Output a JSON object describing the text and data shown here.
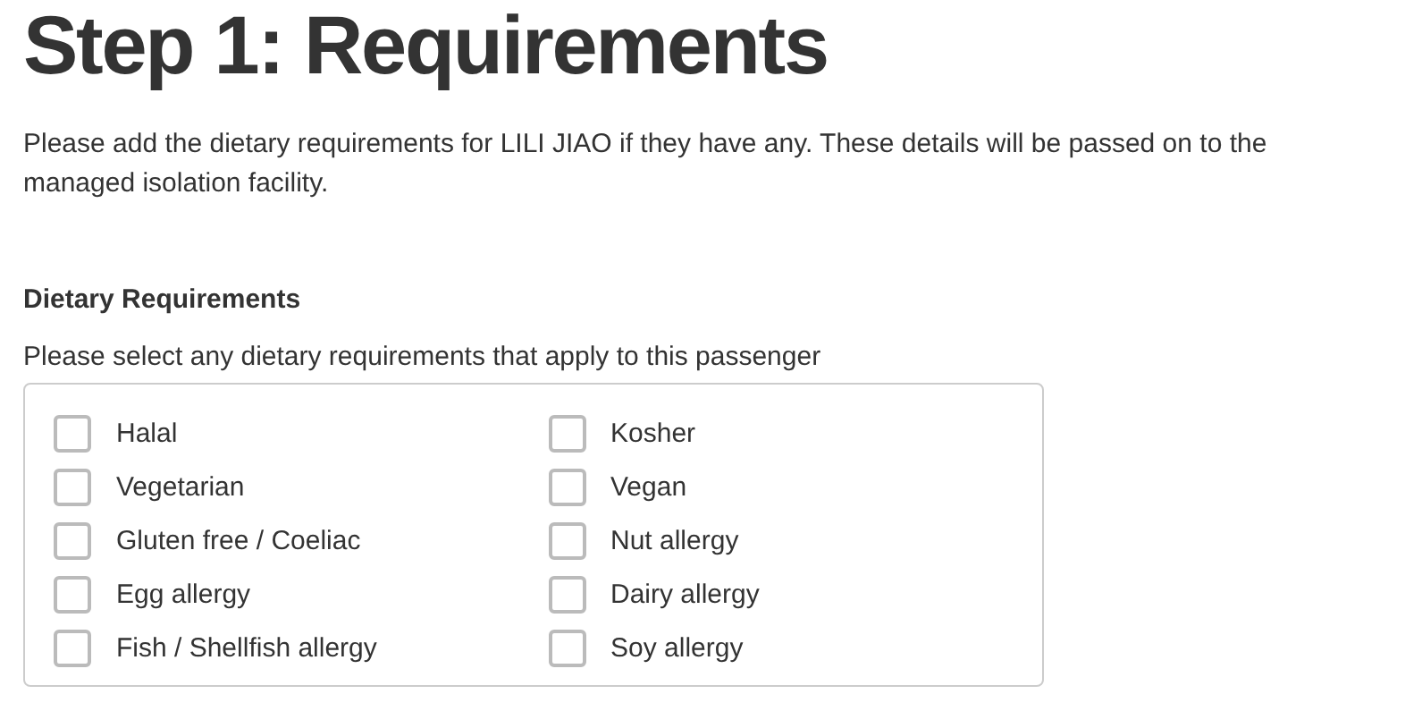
{
  "heading": "Step 1: Requirements",
  "intro": "Please add the dietary requirements for LILI JIAO if they have any. These details will be passed on to the managed isolation facility.",
  "section": {
    "title": "Dietary Requirements",
    "hint": "Please select any dietary requirements that apply to this passenger"
  },
  "options": [
    {
      "label": "Halal",
      "checked": false
    },
    {
      "label": "Kosher",
      "checked": false
    },
    {
      "label": "Vegetarian",
      "checked": false
    },
    {
      "label": "Vegan",
      "checked": false
    },
    {
      "label": "Gluten free / Coeliac",
      "checked": false
    },
    {
      "label": "Nut allergy",
      "checked": false
    },
    {
      "label": "Egg allergy",
      "checked": false
    },
    {
      "label": "Dairy allergy",
      "checked": false
    },
    {
      "label": "Fish / Shellfish allergy",
      "checked": false
    },
    {
      "label": "Soy allergy",
      "checked": false
    }
  ]
}
